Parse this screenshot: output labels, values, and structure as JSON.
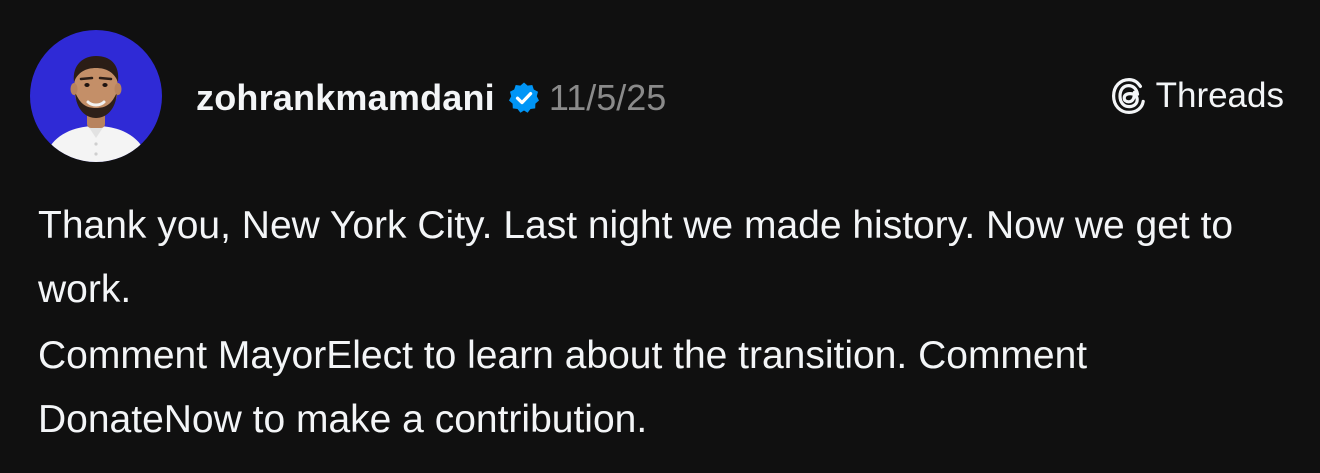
{
  "post": {
    "author": {
      "username": "zohrankmamdani",
      "verified": true,
      "avatar_icon": "profile-photo"
    },
    "date": "11/5/25",
    "platform": {
      "label": "Threads",
      "icon": "threads-logo-icon"
    },
    "paragraphs": [
      "Thank you, New York City. Last night we made history. Now we get to work.",
      "Comment MayorElect to learn about the transition. Comment DonateNow to make a contribution."
    ]
  },
  "colors": {
    "background": "#101010",
    "text": "#f3f5f7",
    "muted": "#8a8a8a",
    "verified_badge": "#0095f6",
    "avatar_bg": "#2f2ad6"
  }
}
